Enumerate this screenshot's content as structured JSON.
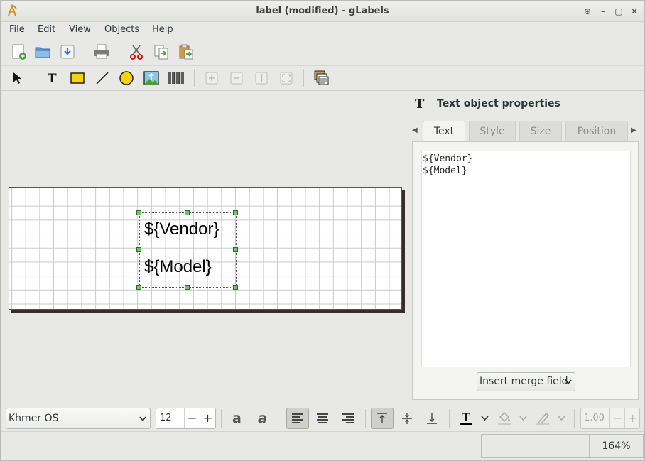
{
  "window": {
    "title": "label (modified) - gLabels"
  },
  "menu": [
    "File",
    "Edit",
    "View",
    "Objects",
    "Help"
  ],
  "canvas": {
    "object_lines": [
      "${Vendor}",
      "${Model}"
    ]
  },
  "properties": {
    "title": "Text object properties",
    "tabs": [
      "Text",
      "Style",
      "Size",
      "Position"
    ],
    "active_tab": "Text",
    "text_lines": [
      "${Vendor}",
      "${Model}"
    ],
    "merge_button": "Insert merge field"
  },
  "format": {
    "font_family": "Khmer OS",
    "font_size": "12",
    "line_width": "1.00",
    "text_color": "#000000"
  },
  "status": {
    "position": "",
    "zoom": "164%"
  },
  "colors": {
    "handle": "#6fc56a",
    "accent_red": "#d11"
  }
}
